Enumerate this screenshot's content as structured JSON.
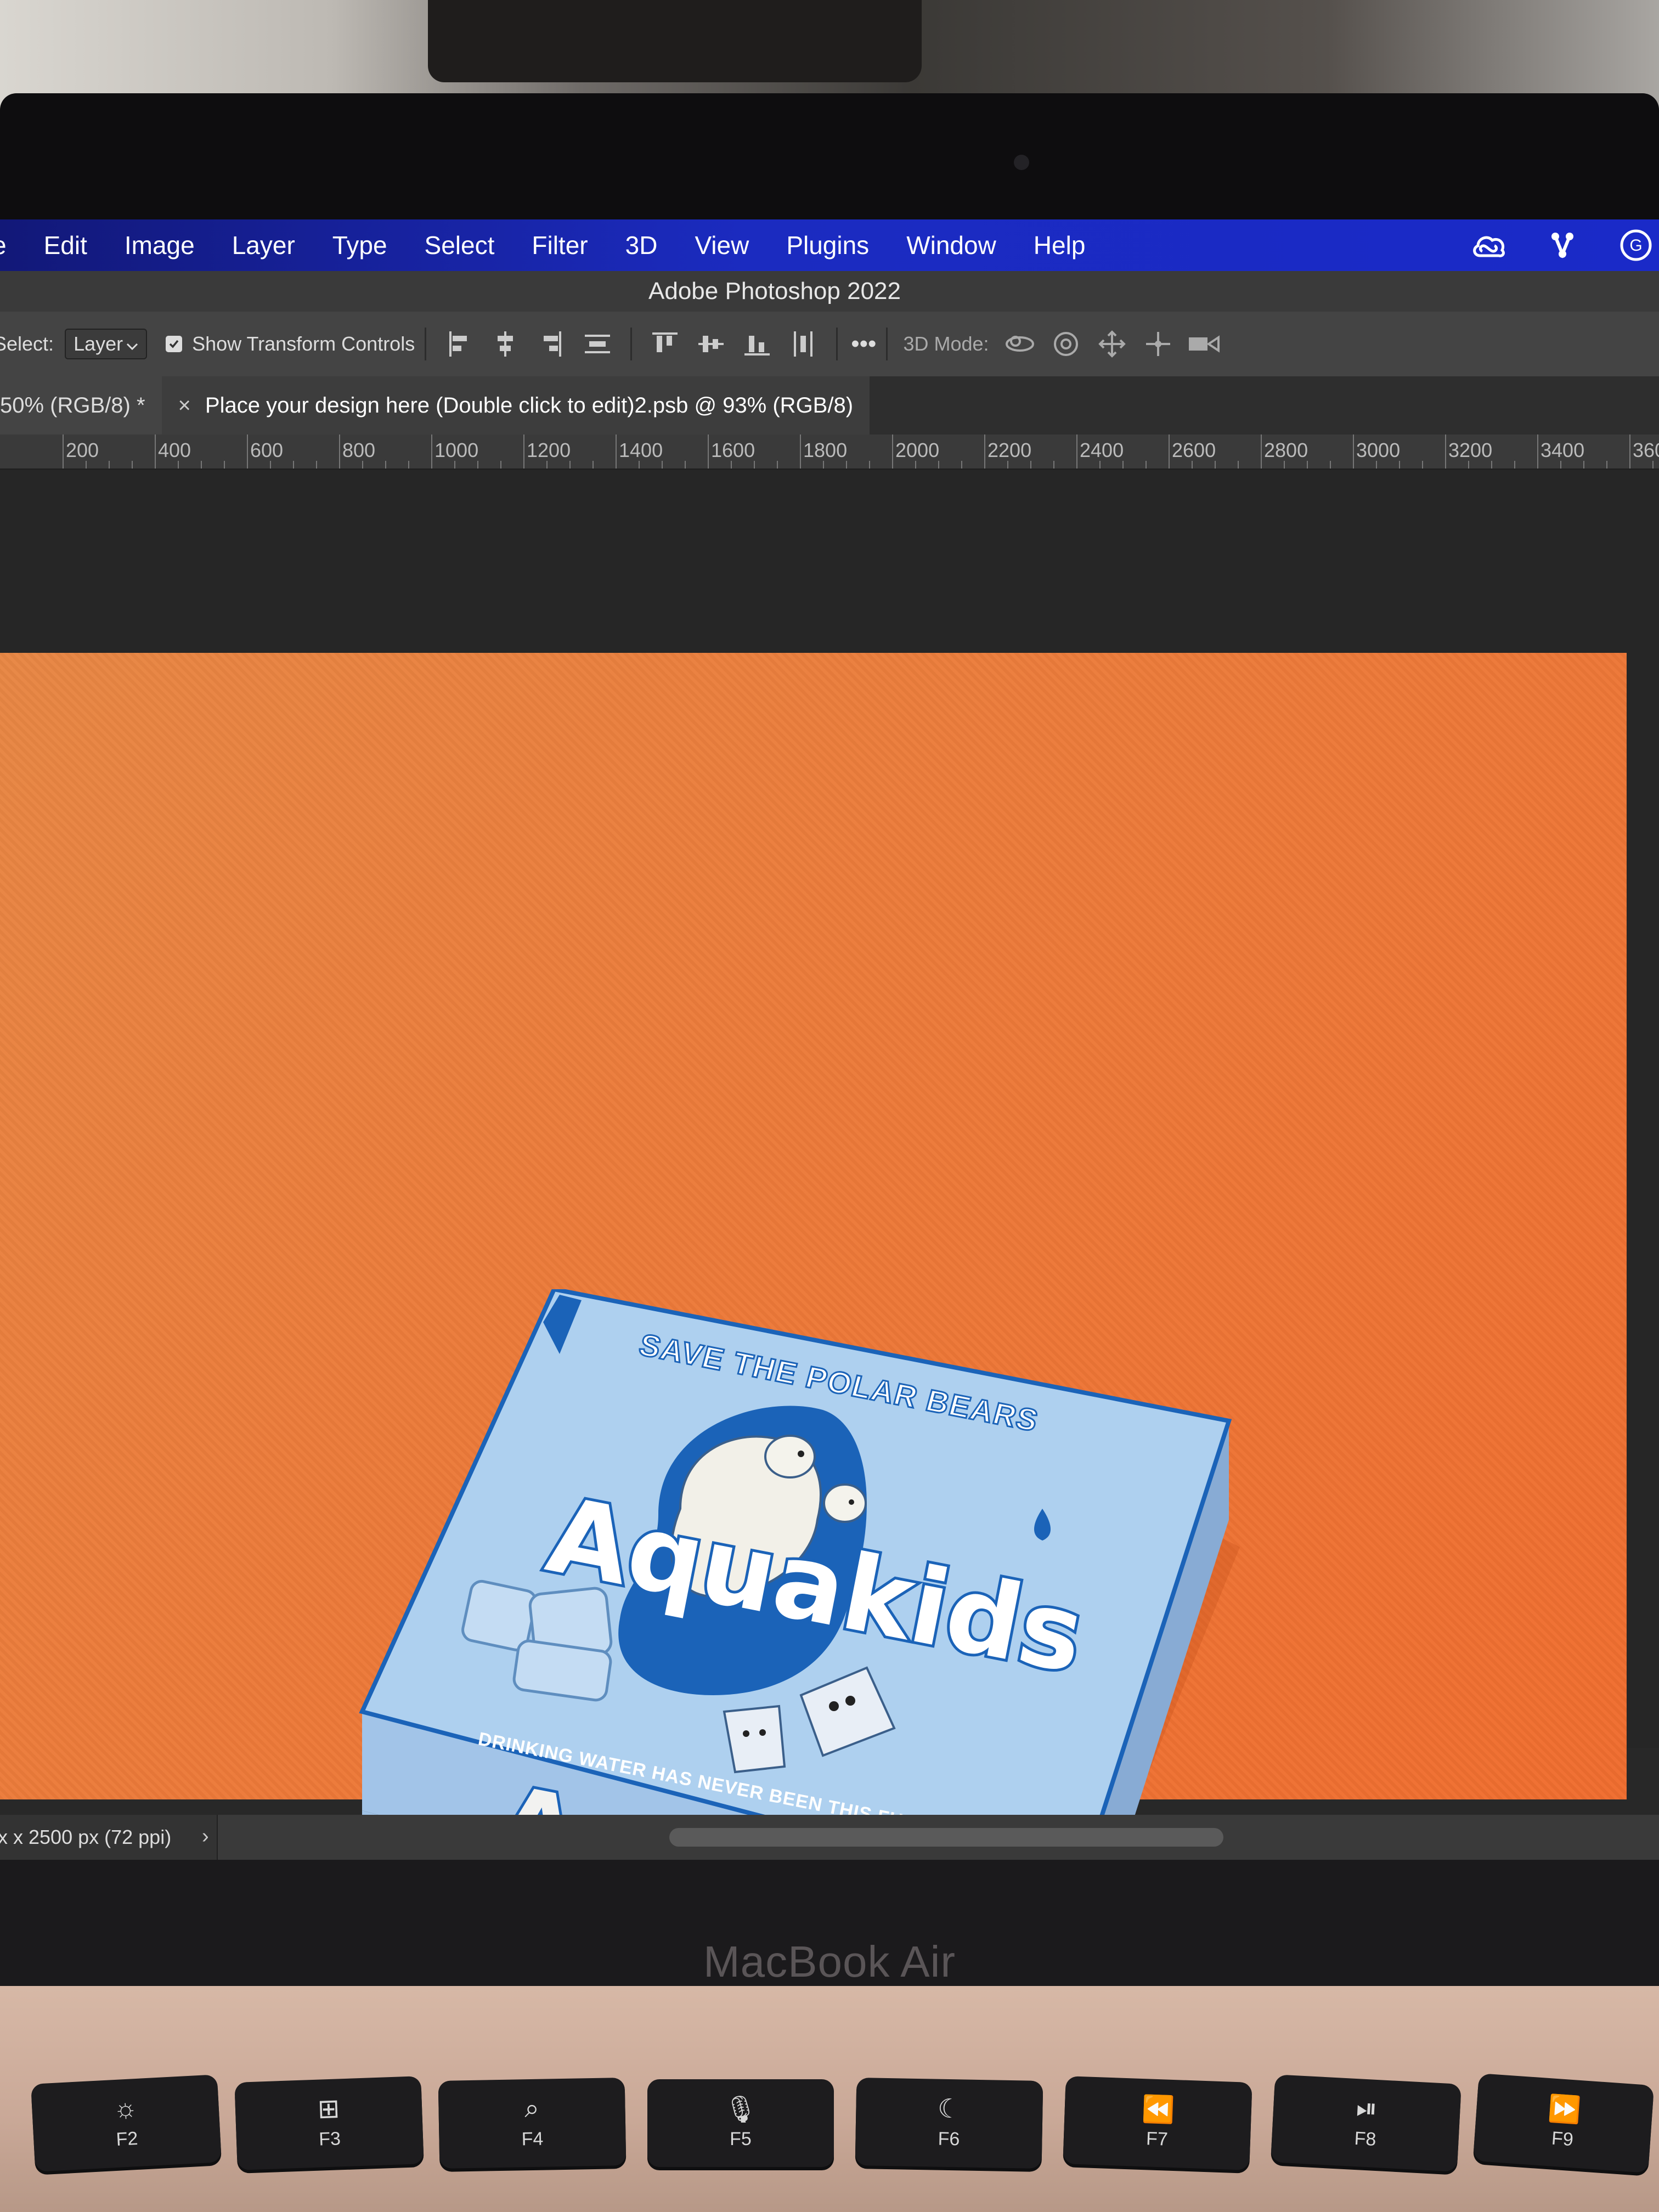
{
  "menubar": {
    "items": [
      "e",
      "Edit",
      "Image",
      "Layer",
      "Type",
      "Select",
      "Filter",
      "3D",
      "View",
      "Plugins",
      "Window",
      "Help"
    ]
  },
  "app_title": "Adobe Photoshop 2022",
  "options_bar": {
    "select_label": "Select:",
    "select_value": "Layer",
    "show_transform_label": "Show Transform Controls",
    "show_transform_checked": true,
    "more_label": "•••",
    "mode_label": "3D Mode:"
  },
  "tabs": [
    {
      "label": "50% (RGB/8) *",
      "active": false
    },
    {
      "label": "Place your design here (Double click to edit)2.psb @ 93% (RGB/8)",
      "active": true,
      "close": "×"
    }
  ],
  "ruler": {
    "labels": [
      "200",
      "400",
      "600",
      "800",
      "1000",
      "1200",
      "1400",
      "1600",
      "1800",
      "2000",
      "2200",
      "2400",
      "2600",
      "2800",
      "3000",
      "3200",
      "3400",
      "360"
    ]
  },
  "mockup": {
    "lid_tagline": "SAVE THE POLAR BEARS",
    "brand": "Aquakids",
    "slogan": "DRINKING WATER HAS NEVER BEEN THIS FUN!",
    "side_brand": "Aquakids"
  },
  "status_bar": {
    "doc_size": "x x 2500 px (72 ppi)",
    "arrow": "›"
  },
  "laptop": {
    "brand": "MacBook Air",
    "keys": [
      {
        "label": "F2",
        "icon": "☼"
      },
      {
        "label": "F3",
        "icon": "⊞"
      },
      {
        "label": "F4",
        "icon": "⌕"
      },
      {
        "label": "F5",
        "icon": "🎙"
      },
      {
        "label": "F6",
        "icon": "☾"
      },
      {
        "label": "F7",
        "icon": "⏪"
      },
      {
        "label": "F8",
        "icon": "⏯"
      },
      {
        "label": "F9",
        "icon": "⏩"
      }
    ]
  },
  "colors": {
    "menubar": "#1b2bc0",
    "canvas_orange": "#ec7c3b",
    "box_blue": "#a9cdee",
    "box_dark_blue": "#1b63b8"
  },
  "icons": {
    "tray": [
      "creative-cloud-icon",
      "share-icon",
      "user-avatar-icon"
    ]
  }
}
